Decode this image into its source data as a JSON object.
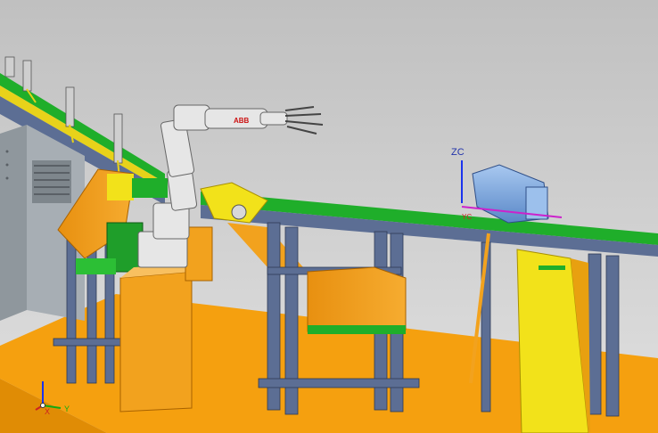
{
  "viewport": {
    "background_top": "#c4c4c4",
    "background_bottom": "#dcdcdc"
  },
  "axis_labels": {
    "zc": "ZC",
    "yc": "YC"
  },
  "triad": {
    "x": "X",
    "y": "Y"
  },
  "robot": {
    "brand": "ABB"
  },
  "colors": {
    "floor": "#f5a00f",
    "orange_part": "#f2a21e",
    "frame_blue": "#5c6e94",
    "frame_dark": "#3f4c6b",
    "conveyor_green": "#1fae2a",
    "yellow": "#f2e21a",
    "cabinet": "#9aa2a8",
    "robot_white": "#e6e6e6",
    "motor_blue": "#7aa8e0"
  }
}
